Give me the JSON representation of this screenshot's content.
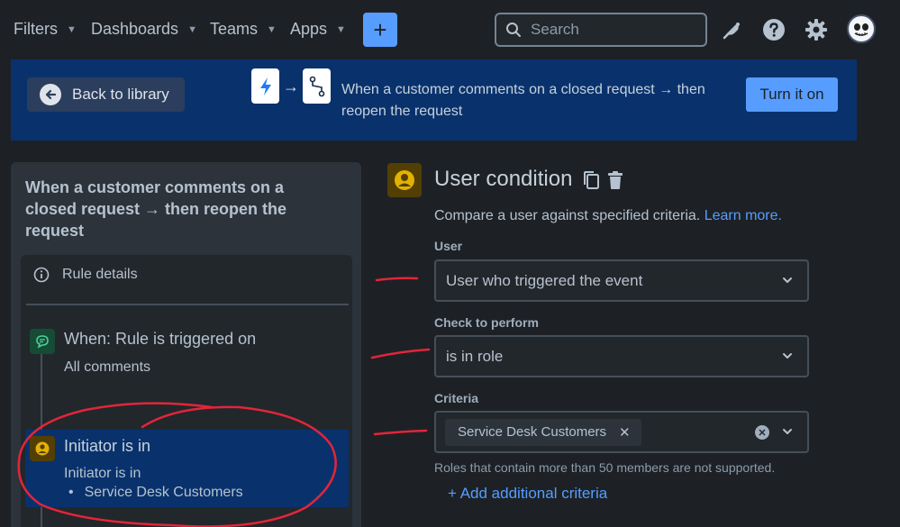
{
  "nav": {
    "items": [
      {
        "label": "Filters"
      },
      {
        "label": "Dashboards"
      },
      {
        "label": "Teams"
      },
      {
        "label": "Apps"
      }
    ],
    "create_label": "+",
    "search_placeholder": "Search"
  },
  "banner": {
    "back_label": "Back to library",
    "description": "When a customer comments on a closed request → then reopen the request",
    "turn_on_label": "Turn it on"
  },
  "left": {
    "title": "When a customer comments on a closed request → then reopen the request",
    "rule_details_label": "Rule details",
    "trigger": {
      "title": "When: Rule is triggered on",
      "subtitle": "All comments"
    },
    "selected": {
      "title": "Initiator is in",
      "subtitle": "Initiator is in",
      "bullet": "Service Desk Customers"
    }
  },
  "condition": {
    "title": "User condition",
    "description": "Compare a user against specified criteria.",
    "learn_more": "Learn more.",
    "user_label": "User",
    "user_value": "User who triggered the event",
    "check_label": "Check to perform",
    "check_value": "is in role",
    "criteria_label": "Criteria",
    "criteria_tag": "Service Desk Customers",
    "hint": "Roles that contain more than 50 members are not supported.",
    "add_criteria": "+ Add additional criteria"
  },
  "colors": {
    "accent": "#579dff",
    "banner": "#09326c",
    "annotation": "#e2253a"
  }
}
